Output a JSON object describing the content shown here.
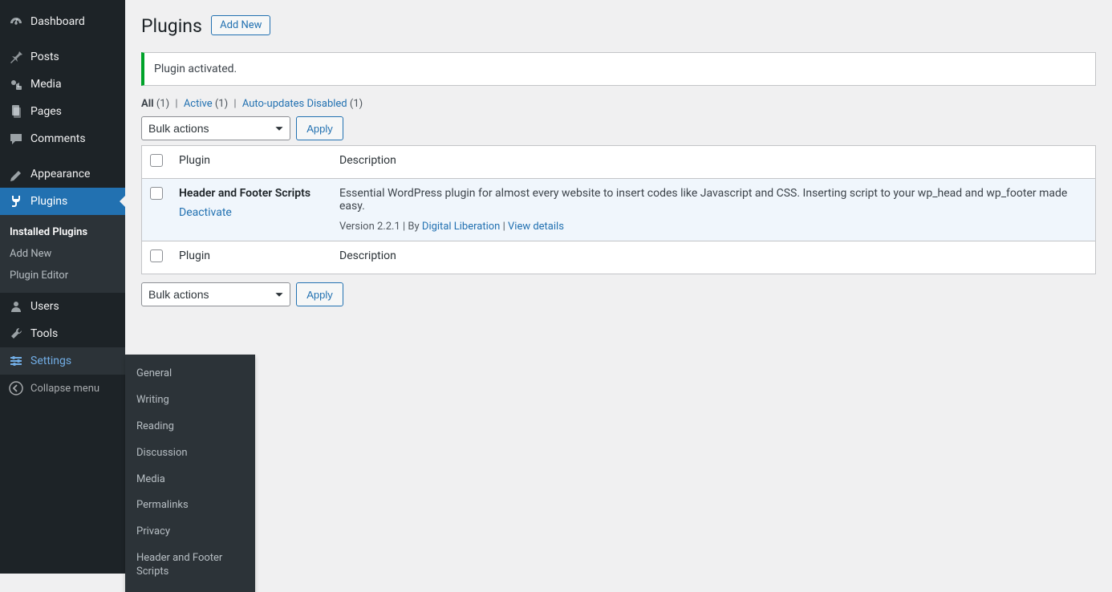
{
  "sidebar": {
    "items": [
      {
        "label": "Dashboard"
      },
      {
        "label": "Posts"
      },
      {
        "label": "Media"
      },
      {
        "label": "Pages"
      },
      {
        "label": "Comments"
      },
      {
        "label": "Appearance"
      },
      {
        "label": "Plugins"
      },
      {
        "label": "Users"
      },
      {
        "label": "Tools"
      },
      {
        "label": "Settings"
      }
    ],
    "plugins_submenu": {
      "items": [
        {
          "label": "Installed Plugins"
        },
        {
          "label": "Add New"
        },
        {
          "label": "Plugin Editor"
        }
      ]
    },
    "settings_submenu": {
      "items": [
        {
          "label": "General"
        },
        {
          "label": "Writing"
        },
        {
          "label": "Reading"
        },
        {
          "label": "Discussion"
        },
        {
          "label": "Media"
        },
        {
          "label": "Permalinks"
        },
        {
          "label": "Privacy"
        },
        {
          "label": "Header and Footer Scripts"
        }
      ]
    },
    "collapse_label": "Collapse menu"
  },
  "header": {
    "title": "Plugins",
    "add_new": "Add New"
  },
  "notice": {
    "message": "Plugin activated."
  },
  "filters": {
    "all_label": "All",
    "all_count": "(1)",
    "active_label": "Active",
    "active_count": "(1)",
    "autoupdates_label": "Auto-updates Disabled",
    "autoupdates_count": "(1)"
  },
  "bulk": {
    "select_label": "Bulk actions",
    "apply_label": "Apply"
  },
  "table": {
    "col_plugin": "Plugin",
    "col_description": "Description",
    "rows": [
      {
        "name": "Header and Footer Scripts",
        "deactivate": "Deactivate",
        "description": "Essential WordPress plugin for almost every website to insert codes like Javascript and CSS. Inserting script to your wp_head and wp_footer made easy.",
        "version": "Version 2.2.1",
        "by": "By",
        "author": "Digital Liberation",
        "view_details": "View details"
      }
    ]
  }
}
